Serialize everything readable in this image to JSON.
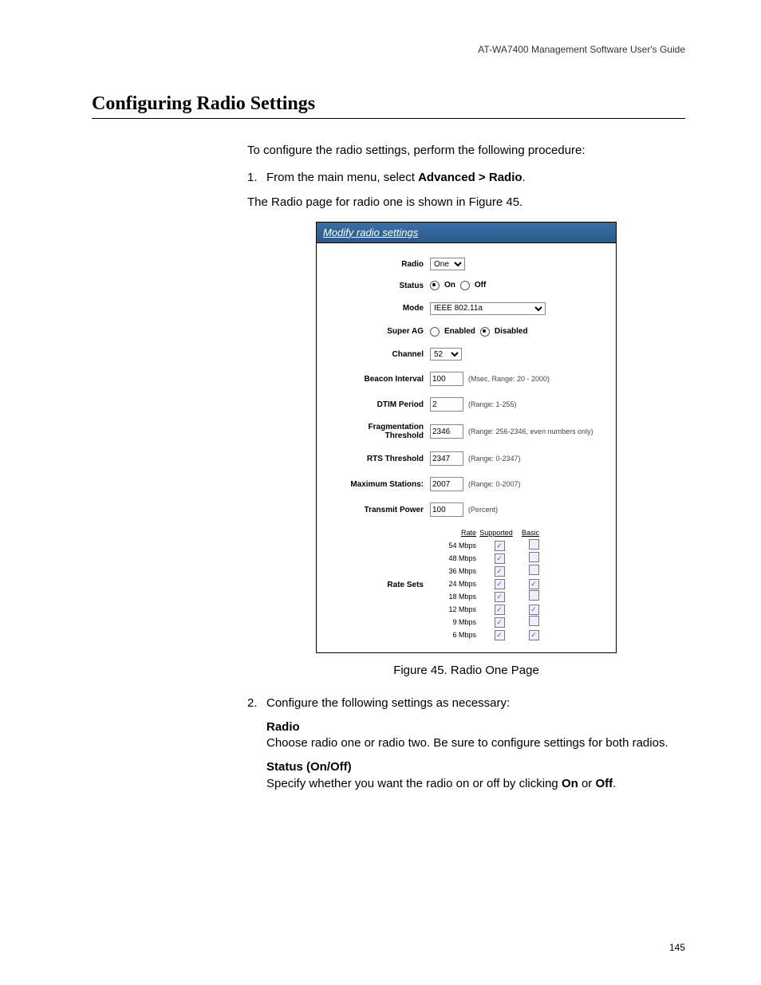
{
  "header": {
    "guide": "AT-WA7400 Management Software User's Guide"
  },
  "title": "Configuring Radio Settings",
  "intro": "To configure the radio settings, perform the following procedure:",
  "step1": {
    "num": "1.",
    "pre": "From the main menu, select ",
    "bold": "Advanced > Radio",
    "post": ".",
    "note": "The Radio page for radio one is shown in Figure 45."
  },
  "figure": {
    "title": "Modify radio settings",
    "caption": "Figure 45. Radio One Page",
    "labels": {
      "radio": "Radio",
      "status": "Status",
      "mode": "Mode",
      "superag": "Super AG",
      "channel": "Channel",
      "beacon": "Beacon Interval",
      "dtim": "DTIM Period",
      "frag": "Fragmentation Threshold",
      "rts": "RTS Threshold",
      "maxsta": "Maximum Stations:",
      "txpower": "Transmit Power",
      "ratesets": "Rate Sets"
    },
    "values": {
      "radio_select": "One",
      "status_on": "On",
      "status_off": "Off",
      "mode": "IEEE 802.11a",
      "superag_enabled": "Enabled",
      "superag_disabled": "Disabled",
      "channel": "52",
      "beacon": "100",
      "dtim": "2",
      "frag": "2346",
      "rts": "2347",
      "maxsta": "2007",
      "txpower": "100"
    },
    "hints": {
      "beacon": "(Msec, Range: 20 - 2000)",
      "dtim": "(Range: 1-255)",
      "frag": "(Range: 256-2346, even numbers only)",
      "rts": "(Range: 0-2347)",
      "maxsta": "(Range: 0-2007)",
      "txpower": "(Percent)"
    },
    "rate_headers": {
      "rate": "Rate",
      "supported": "Supported",
      "basic": "Basic"
    },
    "rates": [
      {
        "label": "54 Mbps",
        "supported": true,
        "basic": false
      },
      {
        "label": "48 Mbps",
        "supported": true,
        "basic": false
      },
      {
        "label": "36 Mbps",
        "supported": true,
        "basic": false
      },
      {
        "label": "24 Mbps",
        "supported": true,
        "basic": true
      },
      {
        "label": "18 Mbps",
        "supported": true,
        "basic": false
      },
      {
        "label": "12 Mbps",
        "supported": true,
        "basic": true
      },
      {
        "label": "9 Mbps",
        "supported": true,
        "basic": false
      },
      {
        "label": "6 Mbps",
        "supported": true,
        "basic": true
      }
    ]
  },
  "step2": {
    "num": "2.",
    "text": "Configure the following settings as necessary:",
    "defs": [
      {
        "term": "Radio",
        "body": "Choose radio one or radio two. Be sure to configure settings for both radios."
      },
      {
        "term": "Status (On/Off)",
        "pre": "Specify whether you want the radio on or off by clicking ",
        "b1": "On",
        "mid": " or ",
        "b2": "Off",
        "post": "."
      }
    ]
  },
  "pagenum": "145"
}
